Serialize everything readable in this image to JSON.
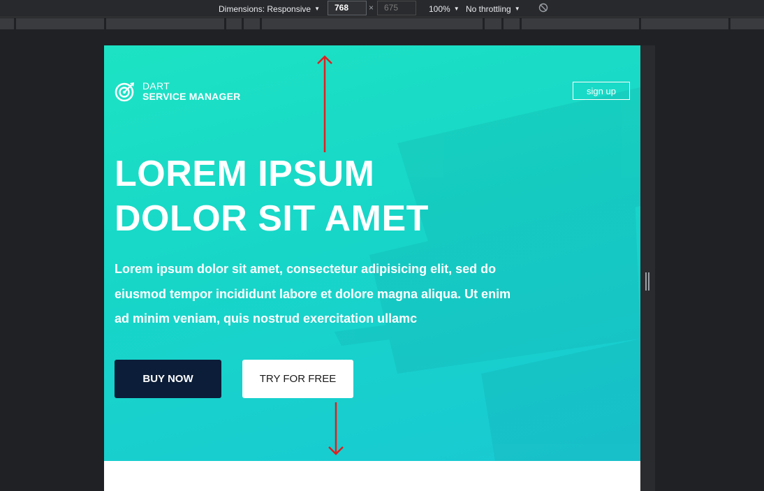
{
  "devtools": {
    "dimensions_label": "Dimensions: Responsive",
    "width_value": "768",
    "times": "×",
    "height_value": "675",
    "zoom": "100%",
    "throttling": "No throttling"
  },
  "site": {
    "logo_top": "DART",
    "logo_bottom": "SERVICE MANAGER",
    "signup": "sign up",
    "headline_line1": "LOREM IPSUM",
    "headline_line2": "DOLOR SIT AMET",
    "lead_line1": "Lorem ipsum dolor sit amet, consectetur adipisicing elit, sed do",
    "lead_line2": "eiusmod tempor incididunt labore et dolore magna aliqua. Ut enim",
    "lead_line3": "ad minim veniam, quis nostrud exercitation ullamc",
    "buy_label": "BUY NOW",
    "try_label": "TRY FOR FREE"
  },
  "colors": {
    "hero_gradient_start": "#1de3c4",
    "hero_gradient_end": "#19c9d3",
    "buy_button_bg": "#0b1d38",
    "annotation_arrow": "#e02020",
    "devtools_bg": "#202124"
  }
}
